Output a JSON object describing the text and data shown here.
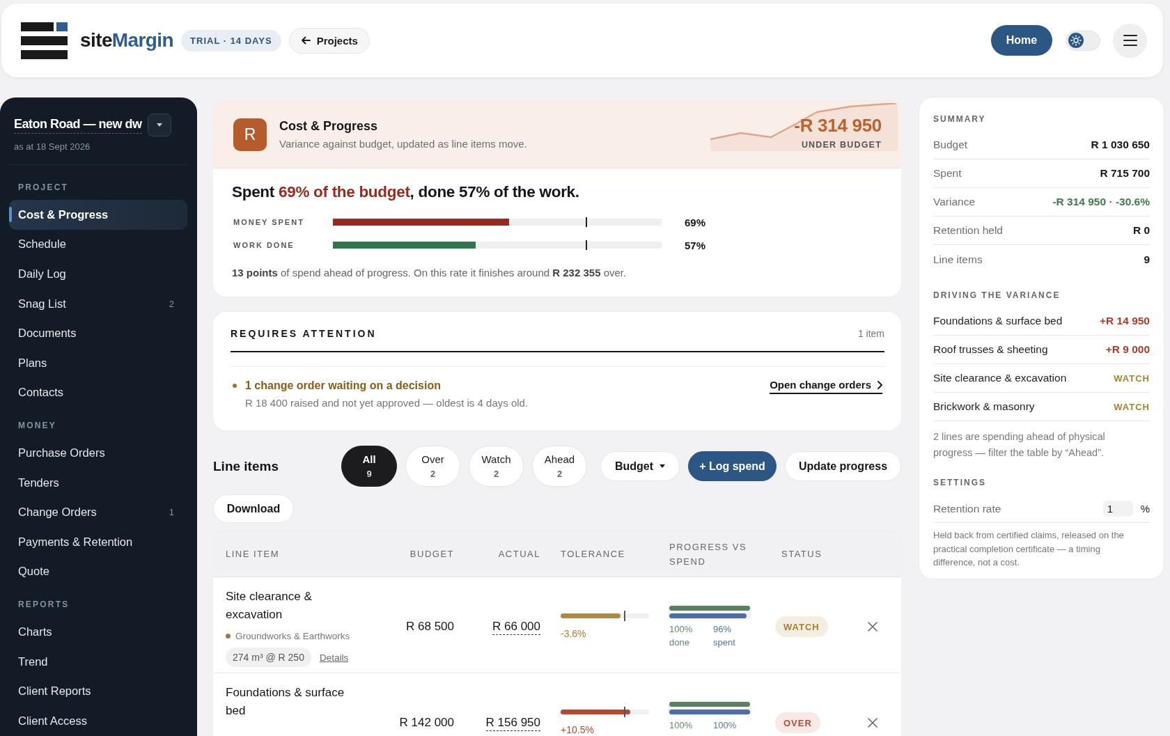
{
  "header": {
    "brand": [
      {
        "text": "site",
        "kind": "plain"
      },
      {
        "text": "Margin",
        "kind": "accent"
      }
    ],
    "trial_badge": "TRIAL · 14 DAYS",
    "back_button": "Projects",
    "home_button": "Home",
    "theme_toggle": {
      "on": false
    }
  },
  "sidebar": {
    "project": {
      "title": "Eaton Road — new dw",
      "date": "as at 18 Sept 2026"
    },
    "sections": [
      {
        "label": "PROJECT",
        "items": [
          {
            "label": "Cost & Progress",
            "selected": true
          },
          {
            "label": "Schedule",
            "selected": false
          },
          {
            "label": "Daily Log",
            "selected": false
          },
          {
            "label": "Snag List",
            "badge": "2",
            "selected": false
          },
          {
            "label": "Documents",
            "selected": false
          },
          {
            "label": "Plans",
            "selected": false
          },
          {
            "label": "Contacts",
            "selected": false
          }
        ]
      },
      {
        "label": "MONEY",
        "items": [
          {
            "label": "Purchase Orders",
            "selected": false
          },
          {
            "label": "Tenders",
            "selected": false
          },
          {
            "label": "Change Orders",
            "badge": "1",
            "selected": false
          },
          {
            "label": "Payments & Retention",
            "selected": false
          },
          {
            "label": "Quote",
            "selected": false
          }
        ]
      },
      {
        "label": "REPORTS",
        "items": [
          {
            "label": "Charts",
            "selected": false
          },
          {
            "label": "Trend",
            "selected": false
          },
          {
            "label": "Client Reports",
            "selected": false
          },
          {
            "label": "Client Access",
            "selected": false
          }
        ]
      }
    ]
  },
  "cost_progress": {
    "tile_letter": "R",
    "title": "Cost & Progress",
    "subtitle": "Variance against budget, updated as line items move.",
    "variance": "-R 314 950",
    "variance_label": "UNDER BUDGET",
    "headline": [
      {
        "text": "Spent ",
        "kind": "plain"
      },
      {
        "text": "69% of the budget",
        "kind": "alert"
      },
      {
        "text": ", done 57% of the work.",
        "kind": "plain"
      }
    ],
    "meters": [
      {
        "label": "MONEY SPENT",
        "level": 0.535,
        "reading": "69%",
        "color": "#952a1e"
      },
      {
        "label": "WORK DONE",
        "level": 0.435,
        "reading": "57%",
        "color": "#2f7550"
      }
    ],
    "note": "**13 points** of spend ahead of progress. On this rate it finishes around **R 232 355** over."
  },
  "attention": {
    "title": "REQUIRES ATTENTION",
    "count": "1 item",
    "items": [
      {
        "title": "1 change order waiting on a decision",
        "detail": "R 18 400 raised and not yet approved — oldest is 4 days old.",
        "action": "Open change orders"
      }
    ]
  },
  "line_items": {
    "title": "Line items",
    "filters": [
      {
        "label": "All",
        "count": "9",
        "selected": true
      },
      {
        "label": "Over",
        "count": "2",
        "selected": false
      },
      {
        "label": "Watch",
        "count": "2",
        "selected": false
      },
      {
        "label": "Ahead",
        "count": "2",
        "selected": false
      }
    ],
    "sort_button": "Budget",
    "log_button": "+ Log spend",
    "update_button": "Update progress",
    "download_button": "Download",
    "table": {
      "columns": [
        "LINE ITEM",
        "BUDGET",
        "ACTUAL",
        "TOLERANCE",
        "PROGRESS VS SPEND",
        "STATUS"
      ],
      "rows": [
        {
          "name": "Site clearance & excavation",
          "category": {
            "label": "Groundworks & Earthworks",
            "color": "#9a7a4e"
          },
          "quantity": "274 m³ @ R 250",
          "details": "Details",
          "budget": "R 68 500",
          "actual": "R 66 000",
          "tolerance": {
            "level": 0.68,
            "reading": "-3.6%"
          },
          "progress": [
            {
              "kind": "done",
              "level": 1,
              "reading": "100%",
              "caption": "done"
            },
            {
              "kind": "spent",
              "level": 0.96,
              "reading": "96%",
              "caption": "spent"
            }
          ],
          "status": {
            "label": "WATCH",
            "kind": "watch"
          }
        },
        {
          "name": "Foundations & surface bed",
          "budget": "R 142 000",
          "actual": "R 156 950",
          "tolerance": {
            "level": 0.79,
            "reading": "+10.5%"
          },
          "progress": [
            {
              "kind": "done",
              "level": 1,
              "reading": "100%"
            },
            {
              "kind": "spent",
              "level": 1,
              "reading": "100%"
            }
          ],
          "status": {
            "label": "OVER",
            "kind": "over"
          }
        }
      ]
    }
  },
  "right_panel": {
    "summary": {
      "title": "SUMMARY",
      "rows": [
        {
          "label": "Budget",
          "value": "R 1 030 650",
          "kind": "plain"
        },
        {
          "label": "Spent",
          "value": "R 715 700",
          "kind": "plain"
        },
        {
          "label": "Variance",
          "value": "-R 314 950 · -30.6%",
          "kind": "good"
        },
        {
          "label": "Retention held",
          "value": "R 0",
          "kind": "plain"
        },
        {
          "label": "Line items",
          "value": "9",
          "kind": "plain"
        }
      ]
    },
    "drivers": {
      "title": "DRIVING THE VARIANCE",
      "rows": [
        {
          "label": "Foundations & surface bed",
          "value": "+R 14 950",
          "kind": "over"
        },
        {
          "label": "Roof trusses & sheeting",
          "value": "+R 9 000",
          "kind": "over"
        },
        {
          "label": "Site clearance & excavation",
          "value": "WATCH",
          "kind": "watch"
        },
        {
          "label": "Brickwork & masonry",
          "value": "WATCH",
          "kind": "watch"
        }
      ],
      "note": "2 lines are spending ahead of physical progress — filter the table by “Ahead”."
    },
    "settings": {
      "title": "SETTINGS",
      "fields": [
        {
          "label": "Retention rate",
          "value": "1",
          "unit": "%"
        }
      ],
      "note": "Held back from certified claims, released on the practical completion certificate — a timing difference, not a cost."
    }
  }
}
